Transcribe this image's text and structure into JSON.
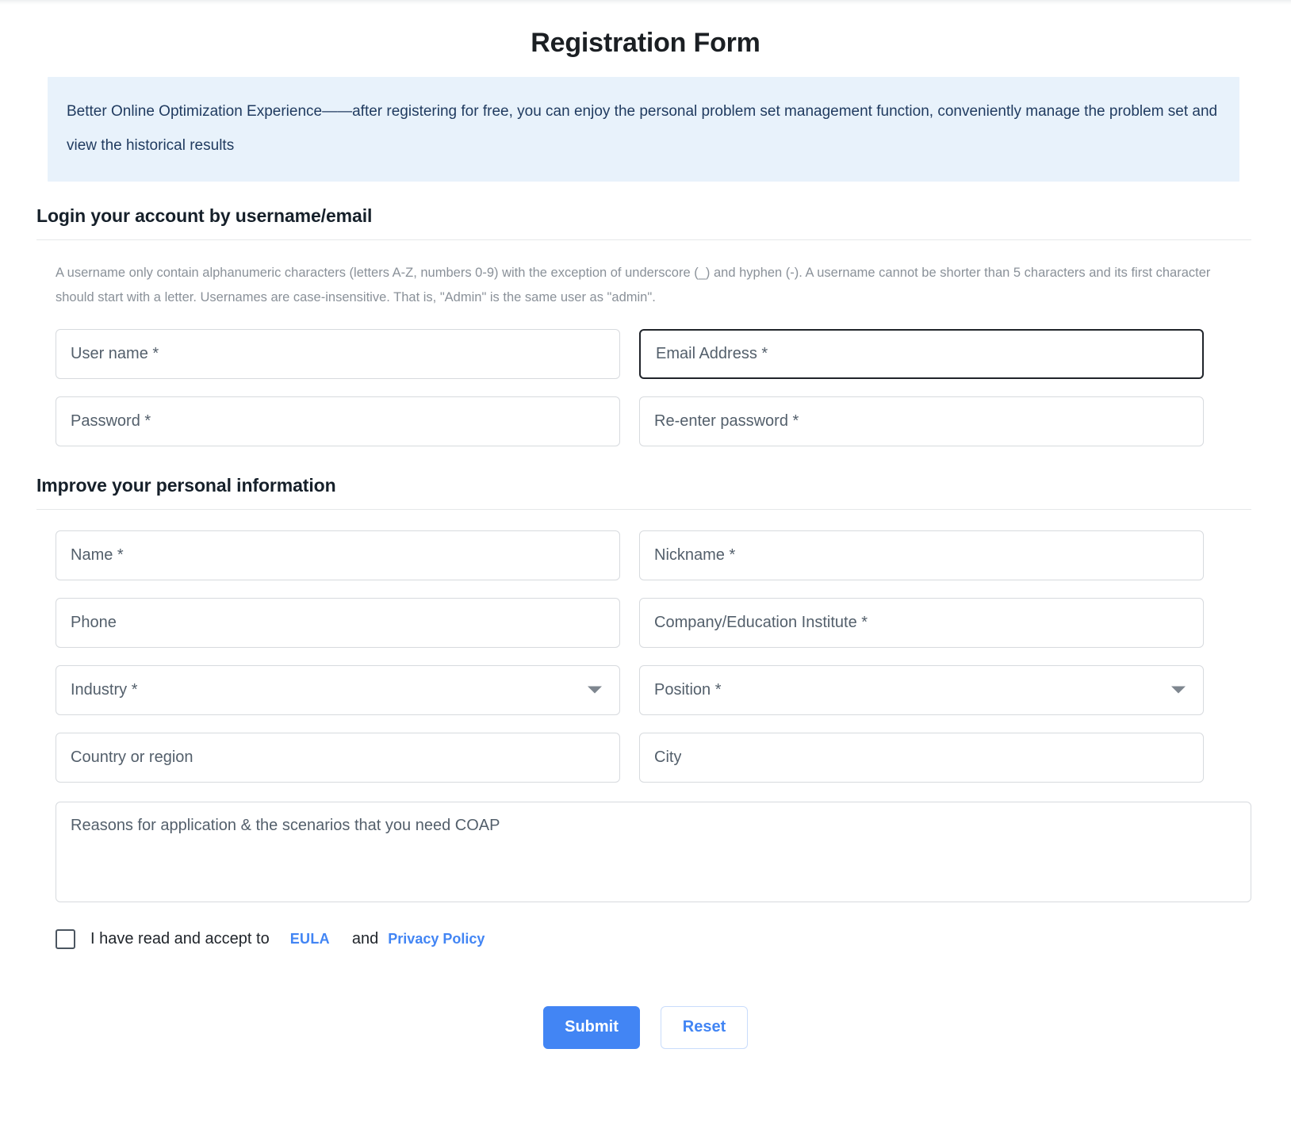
{
  "page": {
    "title": "Registration Form"
  },
  "banner": {
    "text": "Better Online Optimization Experience——after registering for free, you can enjoy the personal problem set management function, conveniently manage the problem set and view the historical results",
    "background_color": "#e8f2fb",
    "text_color": "#1f3a5f"
  },
  "login_section": {
    "heading": "Login your account by username/email",
    "help_text": "A username only contain alphanumeric characters (letters A-Z, numbers 0-9) with the exception of underscore (_) and hyphen (-). A username cannot be shorter than 5 characters and its first character should start with a letter. Usernames are case-insensitive. That is, \"Admin\" is the same user as \"admin\".",
    "fields": [
      {
        "name": "username",
        "placeholder": "User name *",
        "value": "",
        "type": "text",
        "focused": false
      },
      {
        "name": "email",
        "placeholder": "Email Address *",
        "value": "",
        "type": "email",
        "focused": true
      },
      {
        "name": "password",
        "placeholder": "Password *",
        "value": "",
        "type": "password",
        "focused": false
      },
      {
        "name": "reenter_password",
        "placeholder": "Re-enter password *",
        "value": "",
        "type": "password",
        "focused": false
      }
    ]
  },
  "personal_section": {
    "heading": "Improve your personal information",
    "fields": [
      {
        "name": "name",
        "placeholder": "Name *",
        "value": "",
        "type": "text"
      },
      {
        "name": "nickname",
        "placeholder": "Nickname *",
        "value": "",
        "type": "text"
      },
      {
        "name": "phone",
        "placeholder": "Phone",
        "value": "",
        "type": "text"
      },
      {
        "name": "company",
        "placeholder": "Company/Education Institute *",
        "value": "",
        "type": "text"
      },
      {
        "name": "industry",
        "placeholder": "Industry *",
        "value": "",
        "type": "select"
      },
      {
        "name": "position",
        "placeholder": "Position *",
        "value": "",
        "type": "select"
      },
      {
        "name": "country",
        "placeholder": "Country or region",
        "value": "",
        "type": "text"
      },
      {
        "name": "city",
        "placeholder": "City",
        "value": "",
        "type": "text"
      }
    ],
    "reasons": {
      "placeholder": "Reasons for application & the scenarios that you need COAP",
      "value": ""
    }
  },
  "accept": {
    "checked": false,
    "label": "I have read and accept to",
    "eula_link": "EULA",
    "conjunction": "and",
    "privacy_link": "Privacy Policy",
    "link_color": "#4285f4"
  },
  "actions": {
    "submit_label": "Submit",
    "reset_label": "Reset",
    "primary_color": "#4285f4"
  }
}
